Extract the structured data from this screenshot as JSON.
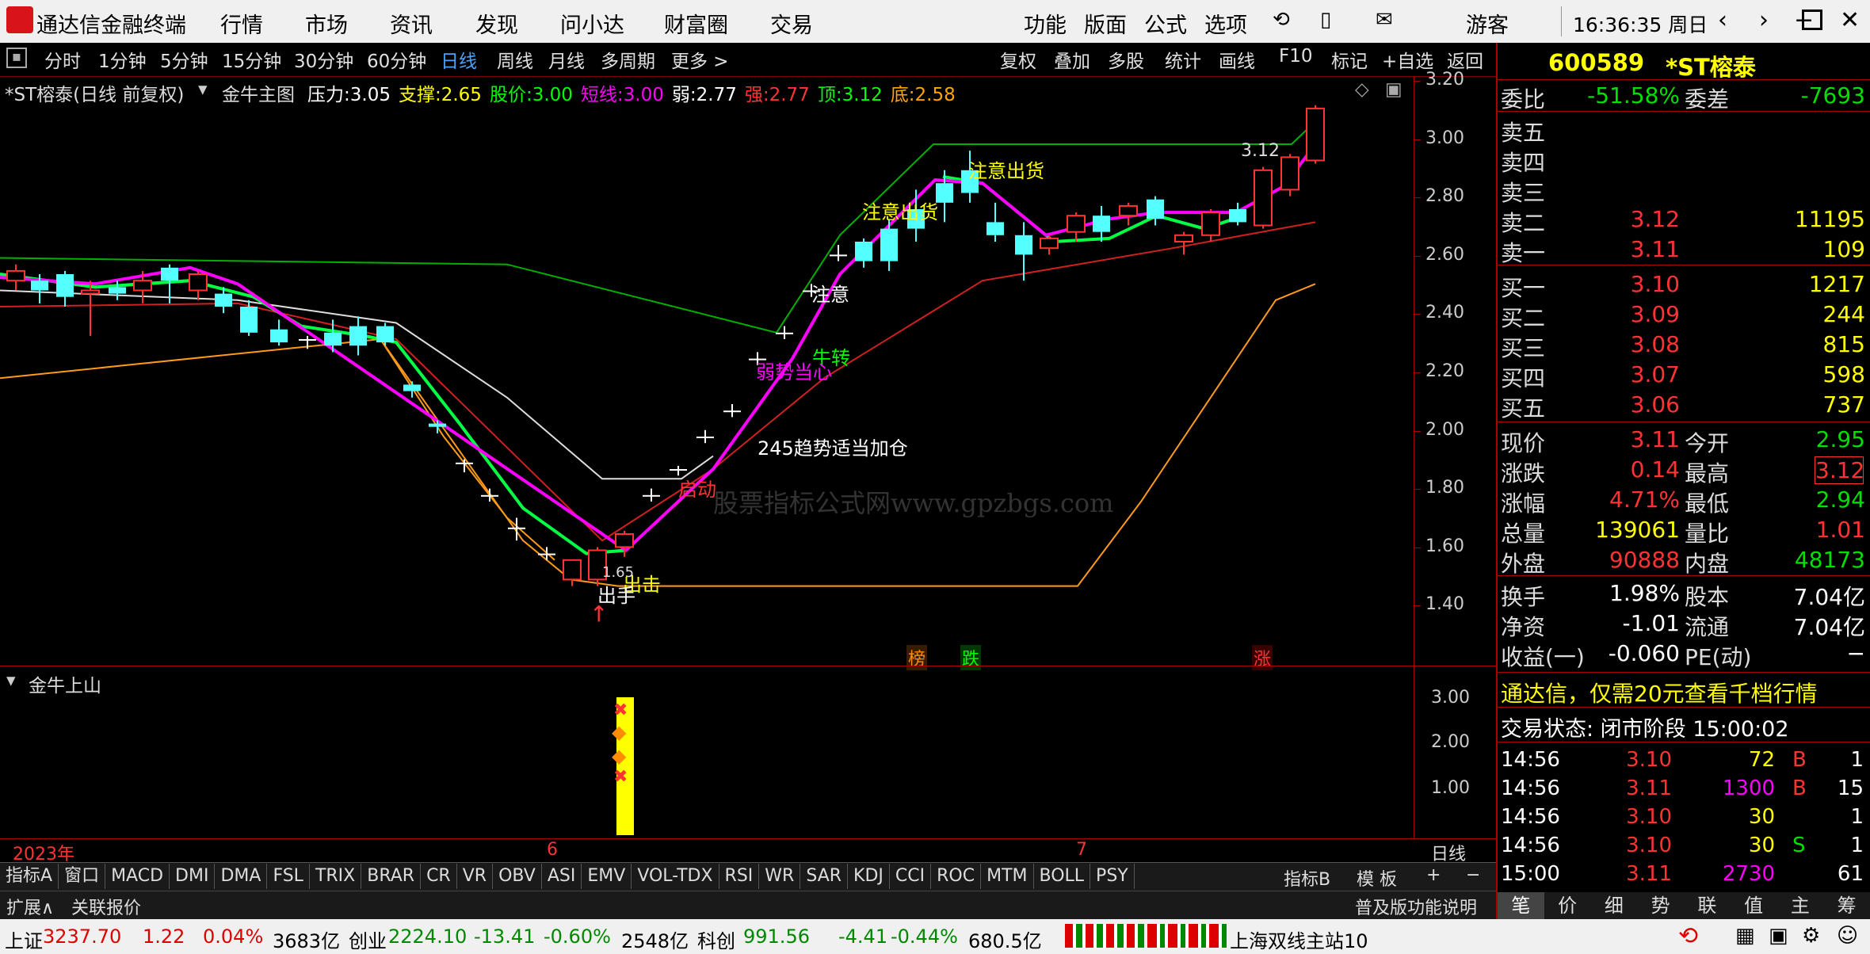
{
  "window": {
    "app_title": "通达信金融终端",
    "menu": [
      "行情",
      "市场",
      "资讯",
      "发现",
      "问小达",
      "财富圈",
      "交易"
    ],
    "right_menu": [
      "功能",
      "版面",
      "公式",
      "选项"
    ],
    "user": "游客",
    "clock": "16:36:35 周日"
  },
  "toolbar": {
    "periods": [
      "分时",
      "1分钟",
      "5分钟",
      "15分钟",
      "30分钟",
      "60分钟",
      "日线",
      "周线",
      "月线",
      "多周期",
      "更多 >"
    ],
    "active_period": "日线",
    "right_items": [
      "复权",
      "叠加",
      "多股",
      "统计",
      "画线",
      "F10",
      "标记",
      "+自选",
      "返回"
    ]
  },
  "chart_header": {
    "title": "*ST榕泰(日线 前复权)",
    "indicator": "金牛主图",
    "items": [
      {
        "label": "压力:",
        "value": "3.05",
        "color": "#ffffff"
      },
      {
        "label": "支撑:",
        "value": "2.65",
        "color": "#ffff00"
      },
      {
        "label": "股价:",
        "value": "3.00",
        "color": "#00ff00"
      },
      {
        "label": "短线:",
        "value": "3.00",
        "color": "#ff00ff"
      },
      {
        "label": "弱:",
        "value": "2.77",
        "color": "#ffffff"
      },
      {
        "label": "强:",
        "value": "2.77",
        "color": "#ff3333"
      },
      {
        "label": "顶:",
        "value": "3.12",
        "color": "#00ff00"
      },
      {
        "label": "底:",
        "value": "2.58",
        "color": "#ffa500"
      }
    ]
  },
  "price_axis": [
    "3.20",
    "3.00",
    "2.80",
    "2.60",
    "2.40",
    "2.20",
    "2.00",
    "1.80",
    "1.60",
    "1.40"
  ],
  "annotations": {
    "top_high": "3.12",
    "attention_sell_1": "注意出货",
    "attention_sell_2": "注意出货",
    "attention": "注意",
    "bull_turn": "牛转",
    "weak_caution": "弱势当心",
    "trend_add": "245趋势适当加仓",
    "start": "启动",
    "strike": "出击",
    "hand": "出手",
    "low_label": "1.65",
    "watermark": "股票指标公式网www.gpzbgs.com",
    "tag_bang": "榜",
    "tag_die": "跌",
    "tag_zhang": "涨"
  },
  "sub_chart": {
    "name": "金牛上山",
    "axis": [
      "3.00",
      "2.00",
      "1.00"
    ]
  },
  "date_axis": {
    "year": "2023年",
    "m6": "6",
    "m7": "7",
    "period": "日线"
  },
  "indicator_tabs": [
    "指标A",
    "窗口",
    "MACD",
    "DMI",
    "DMA",
    "FSL",
    "TRIX",
    "BRAR",
    "CR",
    "VR",
    "OBV",
    "ASI",
    "EMV",
    "VOL-TDX",
    "RSI",
    "WR",
    "SAR",
    "KDJ",
    "CCI",
    "ROC",
    "MTM",
    "BOLL",
    "PSY"
  ],
  "indicator_tabs_right": [
    "指标B",
    "模 板",
    "+",
    "−"
  ],
  "bottom_tabs": [
    "扩展∧",
    "关联报价"
  ],
  "bottom_right": "普及版功能说明",
  "quote": {
    "code": "600589",
    "name": "*ST榕泰",
    "weibi_label": "委比",
    "weibi": "-51.58%",
    "weicha_label": "委差",
    "weicha": "-7693",
    "sells": [
      {
        "label": "卖五",
        "price": "",
        "vol": ""
      },
      {
        "label": "卖四",
        "price": "",
        "vol": ""
      },
      {
        "label": "卖三",
        "price": "",
        "vol": ""
      },
      {
        "label": "卖二",
        "price": "3.12",
        "vol": "11195"
      },
      {
        "label": "卖一",
        "price": "3.11",
        "vol": "109"
      }
    ],
    "buys": [
      {
        "label": "买一",
        "price": "3.10",
        "vol": "1217"
      },
      {
        "label": "买二",
        "price": "3.09",
        "vol": "244"
      },
      {
        "label": "买三",
        "price": "3.08",
        "vol": "815"
      },
      {
        "label": "买四",
        "price": "3.07",
        "vol": "598"
      },
      {
        "label": "买五",
        "price": "3.06",
        "vol": "737"
      }
    ],
    "stats": [
      {
        "l1": "现价",
        "v1": "3.11",
        "c1": "#ff3333",
        "l2": "今开",
        "v2": "2.95",
        "c2": "#00e000"
      },
      {
        "l1": "涨跌",
        "v1": "0.14",
        "c1": "#ff3333",
        "l2": "最高",
        "v2": "3.12",
        "c2": "#ff3333"
      },
      {
        "l1": "涨幅",
        "v1": "4.71%",
        "c1": "#ff3333",
        "l2": "最低",
        "v2": "2.94",
        "c2": "#00e000"
      },
      {
        "l1": "总量",
        "v1": "139061",
        "c1": "#ffff00",
        "l2": "量比",
        "v2": "1.01",
        "c2": "#ff3333"
      },
      {
        "l1": "外盘",
        "v1": "90888",
        "c1": "#ff3333",
        "l2": "内盘",
        "v2": "48173",
        "c2": "#00e000"
      }
    ],
    "stats2": [
      {
        "l1": "换手",
        "v1": "1.98%",
        "l2": "股本",
        "v2": "7.04亿"
      },
      {
        "l1": "净资",
        "v1": "-1.01",
        "l2": "流通",
        "v2": "7.04亿"
      },
      {
        "l1": "收益(一)",
        "v1": "-0.060",
        "l2": "PE(动)",
        "v2": "−"
      }
    ],
    "promo": "通达信，仅需20元查看千档行情",
    "trade_status": "交易状态: 闭市阶段 15:00:02",
    "ticks": [
      {
        "t": "14:56",
        "p": "3.10",
        "v": "72",
        "s": "B",
        "n": "1",
        "vc": "#ffff00",
        "sc": "#ff3333"
      },
      {
        "t": "14:56",
        "p": "3.11",
        "v": "1300",
        "s": "B",
        "n": "15",
        "vc": "#ff00ff",
        "sc": "#ff3333"
      },
      {
        "t": "14:56",
        "p": "3.10",
        "v": "30",
        "s": "",
        "n": "1",
        "vc": "#ffff00",
        "sc": "#ff3333"
      },
      {
        "t": "14:56",
        "p": "3.10",
        "v": "30",
        "s": "S",
        "n": "1",
        "vc": "#ffff00",
        "sc": "#00e000"
      },
      {
        "t": "15:00",
        "p": "3.11",
        "v": "2730",
        "s": "",
        "n": "61",
        "vc": "#ff00ff",
        "sc": "#ff3333"
      }
    ],
    "bottom_tabs": [
      "笔",
      "价",
      "细",
      "势",
      "联",
      "值",
      "主",
      "筹"
    ]
  },
  "status_bar": {
    "sh_label": "上证",
    "sh_val": "3237.70",
    "sh_chg": "1.22",
    "sh_pct": "0.04%",
    "sh_amt": "3683亿",
    "cy_label": "创业",
    "cy_val": "2224.10",
    "cy_chg": "-13.41",
    "cy_pct": "-0.60%",
    "cy_amt": "2548亿",
    "kc_label": "科创",
    "kc_val": "991.56",
    "kc_chg": "-4.41",
    "kc_pct": "-0.44%",
    "kc_amt": "680.5亿",
    "server": "上海双线主站10"
  },
  "colors": {
    "up": "#ff3333",
    "down": "#00e000",
    "axis": "#aa0000",
    "accent_blue": "#4aa3ff"
  }
}
